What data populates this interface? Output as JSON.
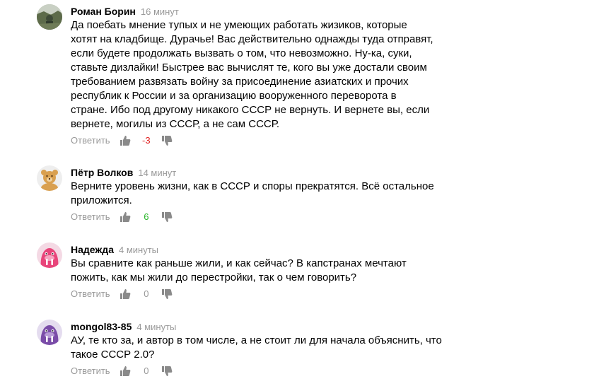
{
  "comments": [
    {
      "author": "Роман Борин",
      "time": "16 минут",
      "text_lines": [
        "Да поебать мнение тупых и не умеющих работать жизиков, которые",
        "хотят на кладбище. Дурачье! Вас действительно однажды туда отправят,",
        "если будете продолжать вызвать о том, что невозможно. Ну-ка, суки,",
        "ставьте дизлайки! Быстрее вас вычислят те, кого вы уже достали своим",
        "требованием развязать войну за присоединение азиатских и прочих",
        "республик к России и за организацию вооруженного переворота в",
        "стране. Ибо под другому никакого СССР не вернуть. И вернете вы, если",
        "вернете, могилы из СССР, а не сам СССР."
      ],
      "reply_label": "Ответить",
      "score": "-3",
      "score_color": "#e02020",
      "avatar": "photo-avatar-icon"
    },
    {
      "author": "Пётр Волков",
      "time": "14 минут",
      "text_lines": [
        "Верните уровень жизни, как в СССР и споры прекратятся. Всё остальное",
        "приложится."
      ],
      "reply_label": "Ответить",
      "score": "6",
      "score_color": "#2ab62a",
      "avatar": "bear-avatar-icon"
    },
    {
      "author": "Надежда",
      "time": "4 минуты",
      "text_lines": [
        "Вы сравните как раньше жили, и как сейчас? В капстранах мечтают",
        "пожить, как мы жили до перестройки, так о чем говорить?"
      ],
      "reply_label": "Ответить",
      "score": "0",
      "score_color": "#999999",
      "avatar": "walrus-avatar-icon"
    },
    {
      "author": "mongol83-85",
      "time": "4 минуты",
      "text_lines": [
        "АУ, те кто за, и автор в том числе, а не стоит ли для начала объяснить, что",
        "такое СССР 2.0?"
      ],
      "reply_label": "Ответить",
      "score": "0",
      "score_color": "#999999",
      "avatar": "walrus-avatar-icon"
    }
  ],
  "colors": {
    "muted": "#999999",
    "icon": "#8a8a8a",
    "walrus_pink": "#e8457a",
    "walrus_purple": "#7a4ca8",
    "bear": "#d9a050"
  }
}
